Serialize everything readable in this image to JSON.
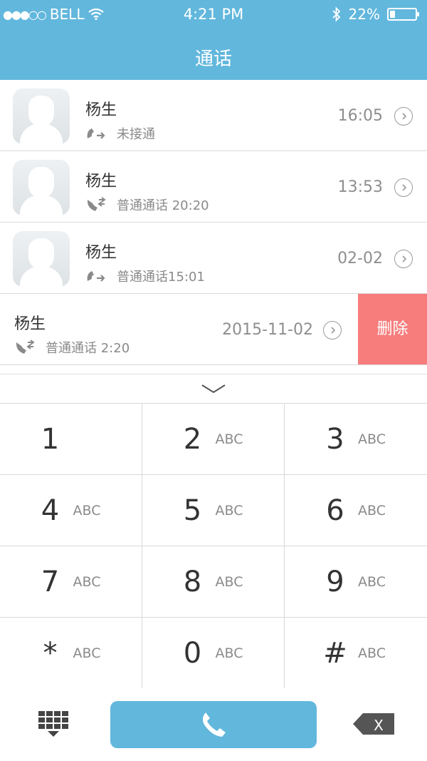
{
  "status_bar": {
    "carrier": "BELL",
    "time": "4:21 PM",
    "battery": "22%",
    "battery_level": 0.22
  },
  "header": {
    "title": "通话"
  },
  "calls": [
    {
      "name": "杨生",
      "detail": "未接通",
      "time": "16:05",
      "type": "outgoing",
      "show_avatar": true
    },
    {
      "name": "杨生",
      "detail": "普通通话 20:20",
      "time": "13:53",
      "type": "incoming",
      "show_avatar": true
    },
    {
      "name": "杨生",
      "detail": "普通通话15:01",
      "time": "02-02",
      "type": "outgoing",
      "show_avatar": true
    },
    {
      "name": "杨生",
      "detail": "普通通话 2:20",
      "time": "2015-11-02",
      "type": "incoming",
      "show_avatar": false,
      "delete_label": "删除"
    }
  ],
  "keypad": {
    "keys": [
      {
        "digit": "1",
        "letters": ""
      },
      {
        "digit": "2",
        "letters": "ABC"
      },
      {
        "digit": "3",
        "letters": "ABC"
      },
      {
        "digit": "4",
        "letters": "ABC"
      },
      {
        "digit": "5",
        "letters": "ABC"
      },
      {
        "digit": "6",
        "letters": "ABC"
      },
      {
        "digit": "7",
        "letters": "ABC"
      },
      {
        "digit": "8",
        "letters": "ABC"
      },
      {
        "digit": "9",
        "letters": "ABC"
      },
      {
        "digit": "*",
        "letters": "ABC"
      },
      {
        "digit": "0",
        "letters": "ABC"
      },
      {
        "digit": "#",
        "letters": "ABC"
      }
    ]
  },
  "bottom": {
    "backspace_label": "X"
  },
  "colors": {
    "primary": "#62b7dd",
    "delete": "#f77d7d",
    "text": "#333333",
    "muted": "#8a8a8a"
  },
  "icons": {
    "signal": "signal-dots-icon",
    "wifi": "wifi-icon",
    "bluetooth": "bluetooth-icon",
    "battery": "battery-icon",
    "outgoing": "outgoing-call-icon",
    "incoming": "incoming-call-icon",
    "chevron": "chevron-right-circle-icon",
    "collapse": "chevron-down-icon",
    "keypad": "keypad-grid-icon",
    "call": "phone-icon",
    "backspace": "backspace-icon"
  }
}
